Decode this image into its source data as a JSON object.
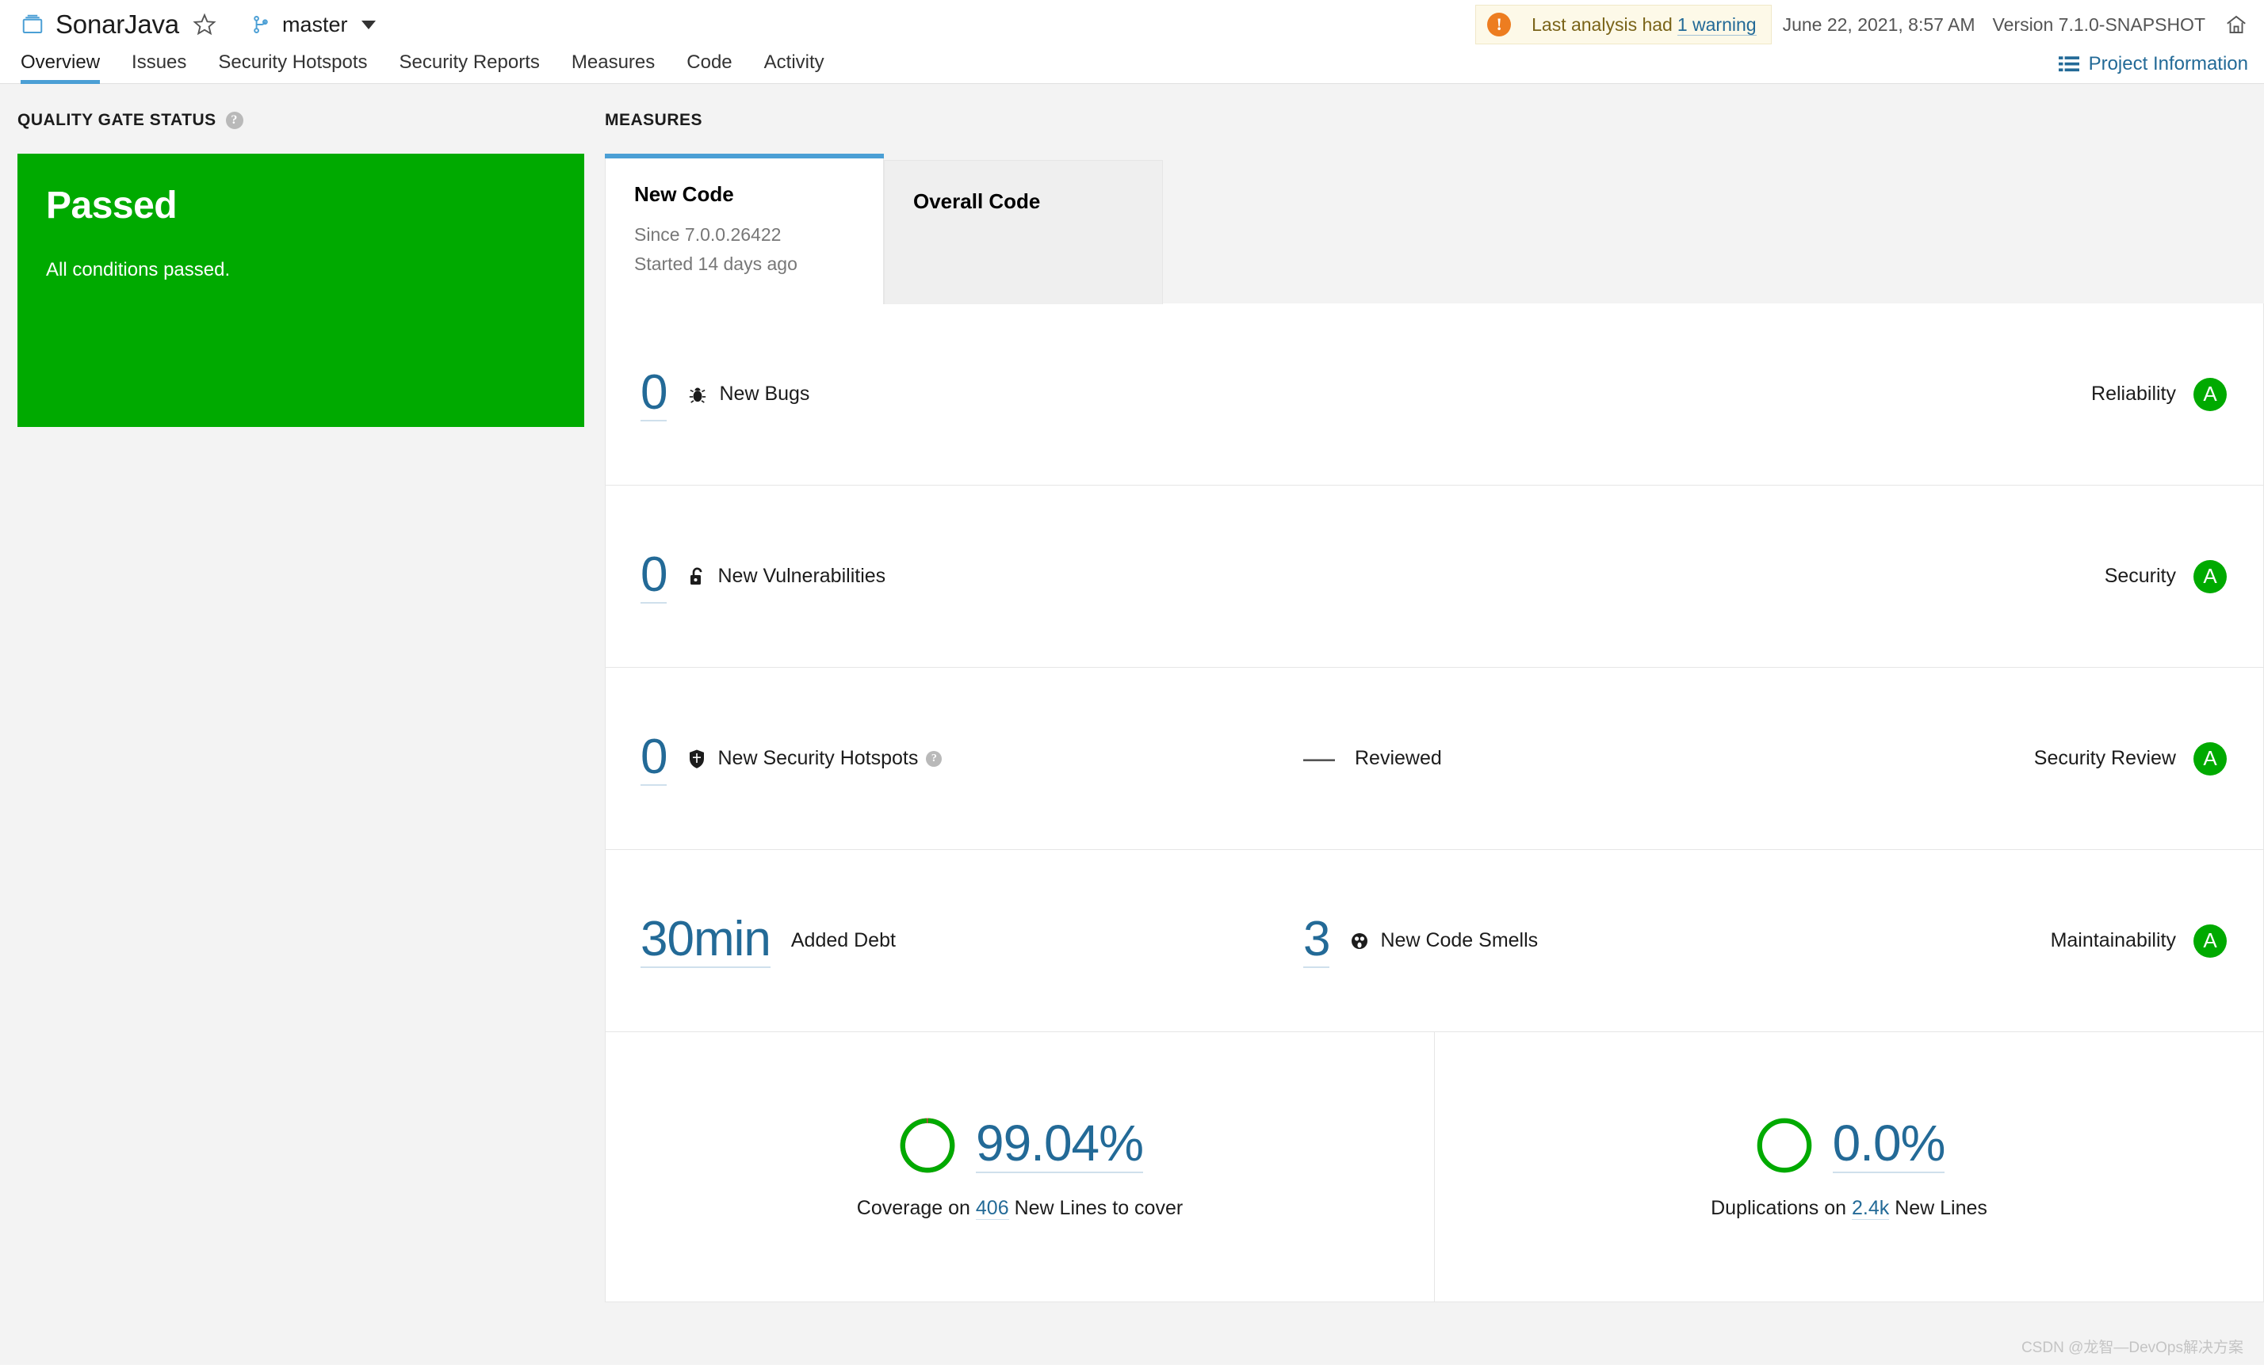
{
  "header": {
    "project_icon": "project-folder-icon",
    "project_name": "SonarJava",
    "favorite_icon": "star-icon",
    "branch_icon": "branch-icon",
    "branch_name": "master",
    "branch_caret": "chevron-down-icon",
    "warning_icon": "alert-circle-icon",
    "warning_text": "Last analysis had",
    "warning_link": "1 warning",
    "analysis_date": "June 22, 2021, 8:57 AM",
    "version": "Version 7.1.0-SNAPSHOT",
    "home_icon": "home-icon"
  },
  "nav": {
    "tabs": [
      {
        "label": "Overview",
        "active": true
      },
      {
        "label": "Issues",
        "active": false
      },
      {
        "label": "Security Hotspots",
        "active": false
      },
      {
        "label": "Security Reports",
        "active": false
      },
      {
        "label": "Measures",
        "active": false
      },
      {
        "label": "Code",
        "active": false
      },
      {
        "label": "Activity",
        "active": false
      }
    ],
    "project_information_icon": "list-icon",
    "project_information": "Project Information"
  },
  "quality_gate": {
    "section_title": "QUALITY GATE STATUS",
    "help_icon": "help-icon",
    "help_glyph": "?",
    "status": "Passed",
    "description": "All conditions passed.",
    "color": "#00aa00"
  },
  "measures": {
    "section_title": "MEASURES",
    "tabs": [
      {
        "title": "New Code",
        "line1": "Since 7.0.0.26422",
        "line2": "Started 14 days ago",
        "active": true
      },
      {
        "title": "Overall Code",
        "line1": "",
        "line2": "",
        "active": false
      }
    ],
    "rows": [
      {
        "value": "0",
        "icon": "bug-icon",
        "label": "New Bugs",
        "has_help": false,
        "secondary_value": "",
        "secondary_label": "",
        "rating_label": "Reliability",
        "rating": "A",
        "rating_color": "#00aa00"
      },
      {
        "value": "0",
        "icon": "open-padlock-icon",
        "label": "New Vulnerabilities",
        "has_help": false,
        "secondary_value": "",
        "secondary_label": "",
        "rating_label": "Security",
        "rating": "A",
        "rating_color": "#00aa00"
      },
      {
        "value": "0",
        "icon": "shield-icon",
        "label": "New Security Hotspots",
        "has_help": true,
        "help_glyph": "?",
        "secondary_value": "—",
        "secondary_label": "Reviewed",
        "rating_label": "Security Review",
        "rating": "A",
        "rating_color": "#00aa00"
      },
      {
        "value": "30min",
        "icon": "",
        "label": "Added Debt",
        "has_help": false,
        "secondary_value": "3",
        "secondary_icon": "code-smell-icon",
        "secondary_label": "New Code Smells",
        "rating_label": "Maintainability",
        "rating": "A",
        "rating_color": "#00aa00"
      }
    ],
    "donuts": [
      {
        "name": "coverage-donut",
        "percent": "99.04%",
        "fraction": 0.9904,
        "ring_color": "#00aa00",
        "gap_color": "#d4333f",
        "caption_prefix": "Coverage on",
        "caption_number": "406",
        "caption_suffix": "New Lines to cover"
      },
      {
        "name": "duplications-donut",
        "percent": "0.0%",
        "fraction": 0.0,
        "ring_color": "#00aa00",
        "gap_color": "#00aa00",
        "caption_prefix": "Duplications on",
        "caption_number": "2.4k",
        "caption_suffix": "New Lines"
      }
    ]
  },
  "watermark": "CSDN @龙智—DevOps解决方案"
}
